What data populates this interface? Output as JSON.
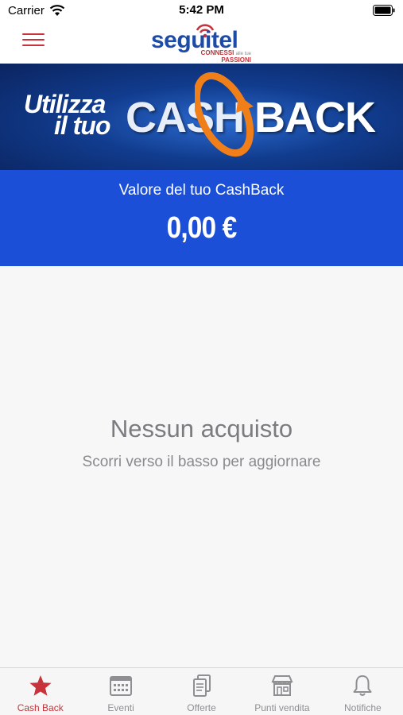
{
  "status_bar": {
    "carrier": "Carrier",
    "time": "5:42 PM"
  },
  "header": {
    "logo_text": "seguitel",
    "logo_tagline_1": "CONNESSI",
    "logo_tagline_2": "alle tue",
    "logo_tagline_3": "PASSIONI",
    "menu_icon": "hamburger-menu-icon"
  },
  "banner": {
    "line1": "Utilizza",
    "line2": "il tuo",
    "word_cash": "CASH",
    "word_back": "BACK"
  },
  "cashback": {
    "label": "Valore del tuo CashBack",
    "value": "0,00 €"
  },
  "empty_state": {
    "title": "Nessun acquisto",
    "subtitle": "Scorri verso il basso per aggiornare"
  },
  "tab_bar": {
    "tabs": [
      {
        "label": "Cash Back",
        "icon": "star-icon",
        "active": true
      },
      {
        "label": "Eventi",
        "icon": "calendar-icon",
        "active": false
      },
      {
        "label": "Offerte",
        "icon": "documents-icon",
        "active": false
      },
      {
        "label": "Punti vendita",
        "icon": "store-icon",
        "active": false
      },
      {
        "label": "Notifiche",
        "icon": "bell-icon",
        "active": false
      }
    ]
  },
  "colors": {
    "accent": "#c8323a",
    "brand_blue": "#1d4ba8",
    "panel_blue": "#1b4fd8",
    "inactive": "#8e8e93"
  }
}
